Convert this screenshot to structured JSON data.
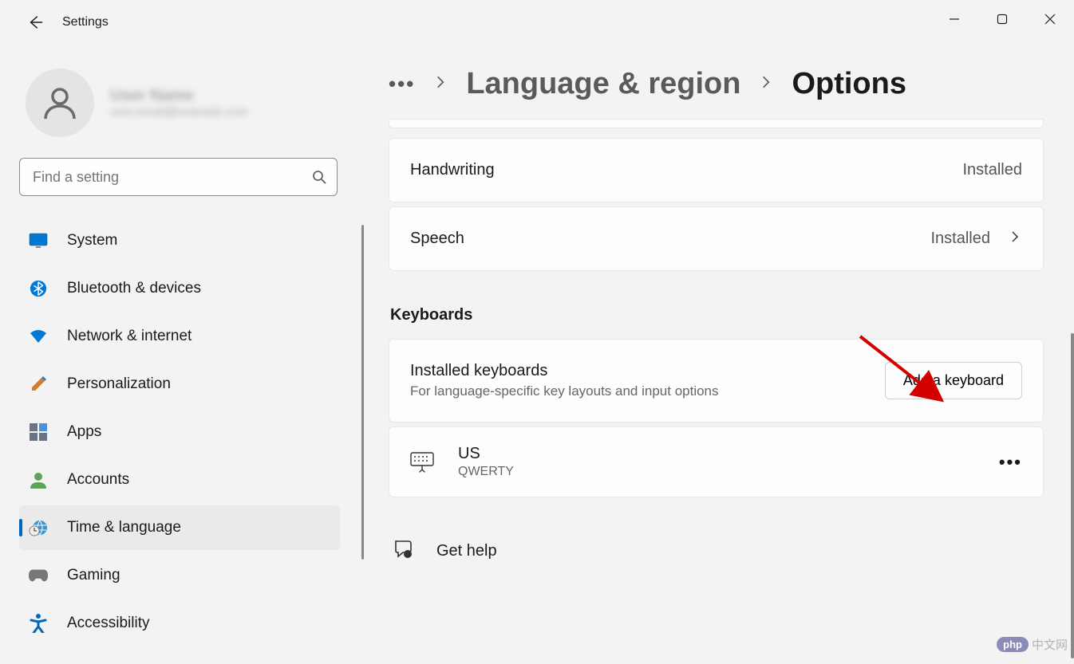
{
  "app_title": "Settings",
  "window_controls": {
    "minimize": "Minimize",
    "maximize": "Maximize",
    "close": "Close"
  },
  "user": {
    "name": "User Name",
    "email": "user.email@example.com"
  },
  "search": {
    "placeholder": "Find a setting"
  },
  "nav": [
    {
      "icon": "🖥️",
      "label": "System"
    },
    {
      "icon": "bluetooth",
      "label": "Bluetooth & devices"
    },
    {
      "icon": "wifi",
      "label": "Network & internet"
    },
    {
      "icon": "🖌️",
      "label": "Personalization"
    },
    {
      "icon": "apps",
      "label": "Apps"
    },
    {
      "icon": "account",
      "label": "Accounts"
    },
    {
      "icon": "clock-globe",
      "label": "Time & language",
      "active": true
    },
    {
      "icon": "🎮",
      "label": "Gaming"
    },
    {
      "icon": "accessibility",
      "label": "Accessibility"
    }
  ],
  "breadcrumb": {
    "more": "•••",
    "parent": "Language & region",
    "current": "Options"
  },
  "cards": {
    "handwriting": {
      "title": "Handwriting",
      "status": "Installed"
    },
    "speech": {
      "title": "Speech",
      "status": "Installed"
    }
  },
  "keyboards": {
    "heading": "Keyboards",
    "installed_title": "Installed keyboards",
    "installed_desc": "For language-specific key layouts and input options",
    "add_button": "Add a keyboard",
    "entries": [
      {
        "name": "US",
        "layout": "QWERTY"
      }
    ]
  },
  "help": {
    "label": "Get help"
  },
  "watermark": {
    "badge": "php",
    "text": "中文网"
  }
}
